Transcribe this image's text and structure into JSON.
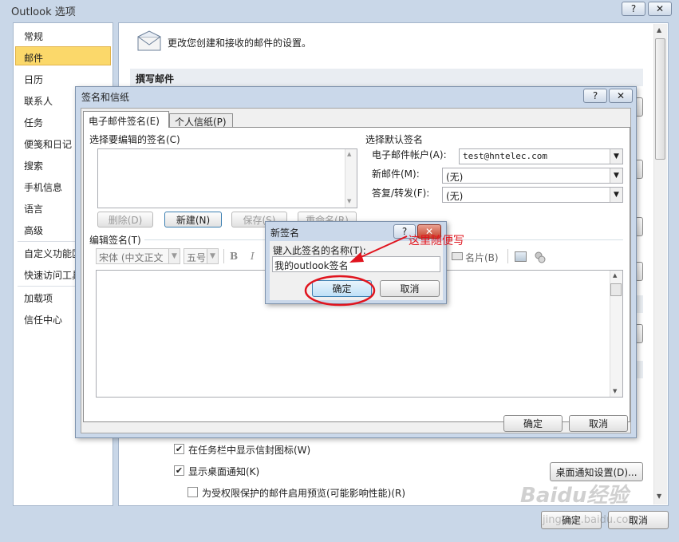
{
  "outer": {
    "title": "Outlook 选项",
    "title_help": "?",
    "title_close": "✕",
    "nav": [
      "常规",
      "邮件",
      "日历",
      "联系人",
      "任务",
      "便笺和日记",
      "搜索",
      "手机信息",
      "语言",
      "高级",
      "自定义功能区",
      "快速访问工具栏",
      "加载项",
      "信任中心"
    ],
    "header_text": "更改您创建和接收的邮件的设置。",
    "section_compose": "撰写邮件",
    "opt_taskbar": "在任务栏中显示信封图标(W)",
    "opt_desktop": "显示桌面通知(K)",
    "opt_preview": "为受权限保护的邮件启用预览(可能影响性能)(R)",
    "btn_desktop_settings": "桌面通知设置(D)...",
    "btn_ok": "确定",
    "btn_cancel": "取消"
  },
  "sig": {
    "title": "签名和信纸",
    "title_help": "?",
    "title_close": "✕",
    "tab_email": "电子邮件签名(E)",
    "tab_personal": "个人信纸(P)",
    "label_select": "选择要编辑的签名(C)",
    "btn_delete": "删除(D)",
    "btn_new": "新建(N)",
    "btn_save": "保存(S)",
    "btn_rename": "重命名(R)",
    "label_default": "选择默认签名",
    "label_account": "电子邮件帐户(A):",
    "account_value": "test@hntelec.com",
    "label_new_msg": "新邮件(M):",
    "new_msg_value": "(无)",
    "label_reply": "答复/转发(F):",
    "reply_value": "(无)",
    "label_edit": "编辑签名(T)",
    "font_value": "宋体 (中文正文",
    "size_value": "五号",
    "bold": "B",
    "italic": "I",
    "card": "名片(B)",
    "btn_ok": "确定",
    "btn_cancel": "取消"
  },
  "newsig": {
    "title": "新签名",
    "title_help": "?",
    "title_close": "✕",
    "label": "键入此签名的名称(T):",
    "input_value": "我的outlook签名",
    "btn_ok": "确定",
    "btn_cancel": "取消"
  },
  "annotation": "这里随便写",
  "watermark": "Baidu经验",
  "watermark_url": "jingyan.baidu.com",
  "colors": {
    "accent_nav": "#fbd86a",
    "annotation_red": "#e0141e",
    "title_bg": "#c9d7e8"
  }
}
